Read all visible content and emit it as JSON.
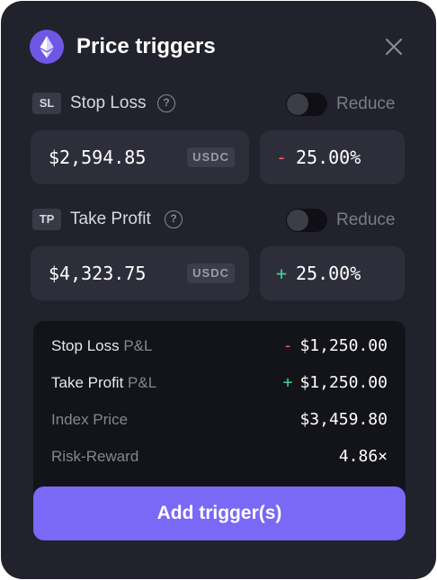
{
  "header": {
    "title": "Price triggers",
    "logo_icon": "ethereum-icon",
    "close_icon": "close-icon"
  },
  "stop_loss": {
    "badge": "SL",
    "label": "Stop Loss",
    "help_icon": "?",
    "reduce_label": "Reduce",
    "reduce_enabled": false,
    "price": "$2,594.85",
    "unit": "USDC",
    "pct_sign": "-",
    "pct_value": "25.00%"
  },
  "take_profit": {
    "badge": "TP",
    "label": "Take Profit",
    "help_icon": "?",
    "reduce_label": "Reduce",
    "reduce_enabled": false,
    "price": "$4,323.75",
    "unit": "USDC",
    "pct_sign": "+",
    "pct_value": "25.00%"
  },
  "summary": {
    "rows": [
      {
        "label_strong": "Stop Loss",
        "label_muted": " P&L",
        "sign": "-",
        "value": "$1,250.00"
      },
      {
        "label_strong": "Take Profit",
        "label_muted": " P&L",
        "sign": "+",
        "value": "$1,250.00"
      },
      {
        "label_strong": "",
        "label_muted": "Index Price",
        "sign": "",
        "value": "$3,459.80"
      },
      {
        "label_strong": "",
        "label_muted": "Risk-Reward",
        "sign": "",
        "value": "4.86×"
      }
    ]
  },
  "cta": {
    "label": "Add trigger(s)"
  },
  "colors": {
    "background": "#22222d",
    "field": "#2e2e3b",
    "accent": "#7a68f6",
    "negative": "#ff5c5c",
    "positive": "#3fd68a"
  }
}
